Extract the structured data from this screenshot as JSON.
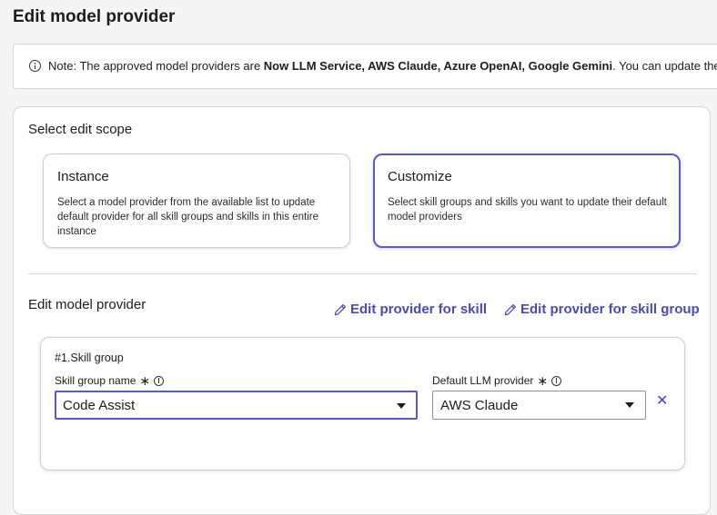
{
  "page": {
    "title": "Edit model provider"
  },
  "note": {
    "prefix": "Note: The approved model providers are ",
    "providers": "Now LLM Service, AWS Claude, Azure OpenAI, Google Gemini",
    "suffix": ". You can update the defa"
  },
  "scope": {
    "heading": "Select edit scope",
    "options": [
      {
        "title": "Instance",
        "description": "Select a model provider from the available list to update default provider for all skill groups and skills in this entire instance",
        "selected": false
      },
      {
        "title": "Customize",
        "description": "Select skill groups and skills you want to update their default model providers",
        "selected": true
      }
    ]
  },
  "edit": {
    "heading": "Edit model provider",
    "edit_skill_label": "Edit provider for skill",
    "edit_skill_group_label": "Edit provider for skill group"
  },
  "skill_group": {
    "title": "#1.Skill group",
    "name_label": "Skill group name",
    "name_value": "Code Assist",
    "provider_label": "Default LLM provider",
    "provider_value": "AWS Claude",
    "required_mark": "∗",
    "remove_glyph": "✕"
  },
  "colors": {
    "accent": "#5a57c9",
    "link": "#4b48b8"
  }
}
